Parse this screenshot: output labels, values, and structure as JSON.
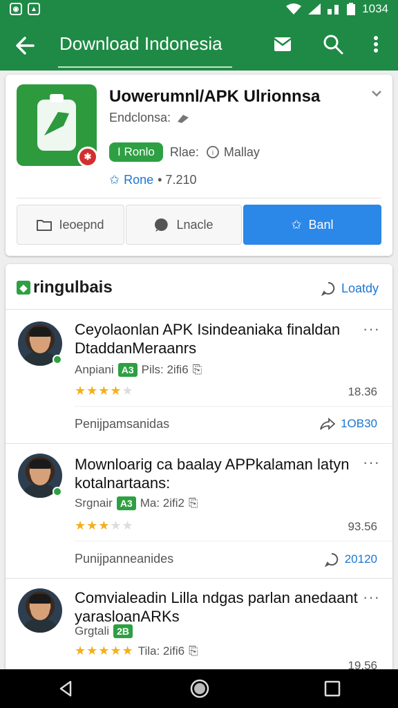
{
  "status_bar": {
    "left_icons": [
      "notification-icon",
      "notification-icon"
    ],
    "time": "1034"
  },
  "app_bar": {
    "title": "Download Indonesia",
    "colors": {
      "primary": "#1e8a45",
      "accent": "#2b87e8"
    }
  },
  "app_card": {
    "name": "Uowerumnl/APK Ulrionnsa",
    "developer": "Endclonsa:",
    "tag": "I Ronlo",
    "language_prefix": "Rlae:",
    "language": "Mallay",
    "rating_label": "Rone",
    "rating_count": "• 7.210",
    "buttons": {
      "first": "Ieoepnd",
      "second": "Lnacle",
      "primary": "Banl"
    }
  },
  "list": {
    "header_title": "ringulbais",
    "header_link": "Loatdy",
    "items": [
      {
        "title": "Ceyolaonlan APK Isindeaniaka finaldan DtaddanMeraanrs",
        "author": "Anpiani",
        "badge": "A3",
        "date": "Pils: 2ifi6",
        "stars": 4,
        "count": "18.36",
        "footer_label": "Penijpamsanidas",
        "footer_value": "1OB30"
      },
      {
        "title": "Mownloarig ca baalay APPkalaman latyn kotalnartaans:",
        "author": "Srgnair",
        "badge": "A3",
        "date": "Ma: 2ifi2",
        "stars": 3,
        "count": "93.56",
        "footer_label": "Punijpanneanides",
        "footer_value": "20120"
      },
      {
        "title": "Comvialeadin Lilla ndgas parlan anedaant yarasloanARKs",
        "author": "Grgtali",
        "badge": "2B",
        "date": "Tila: 2ifi6",
        "stars": 5,
        "count": "19.56",
        "footer_label": "",
        "footer_value": ""
      }
    ]
  }
}
